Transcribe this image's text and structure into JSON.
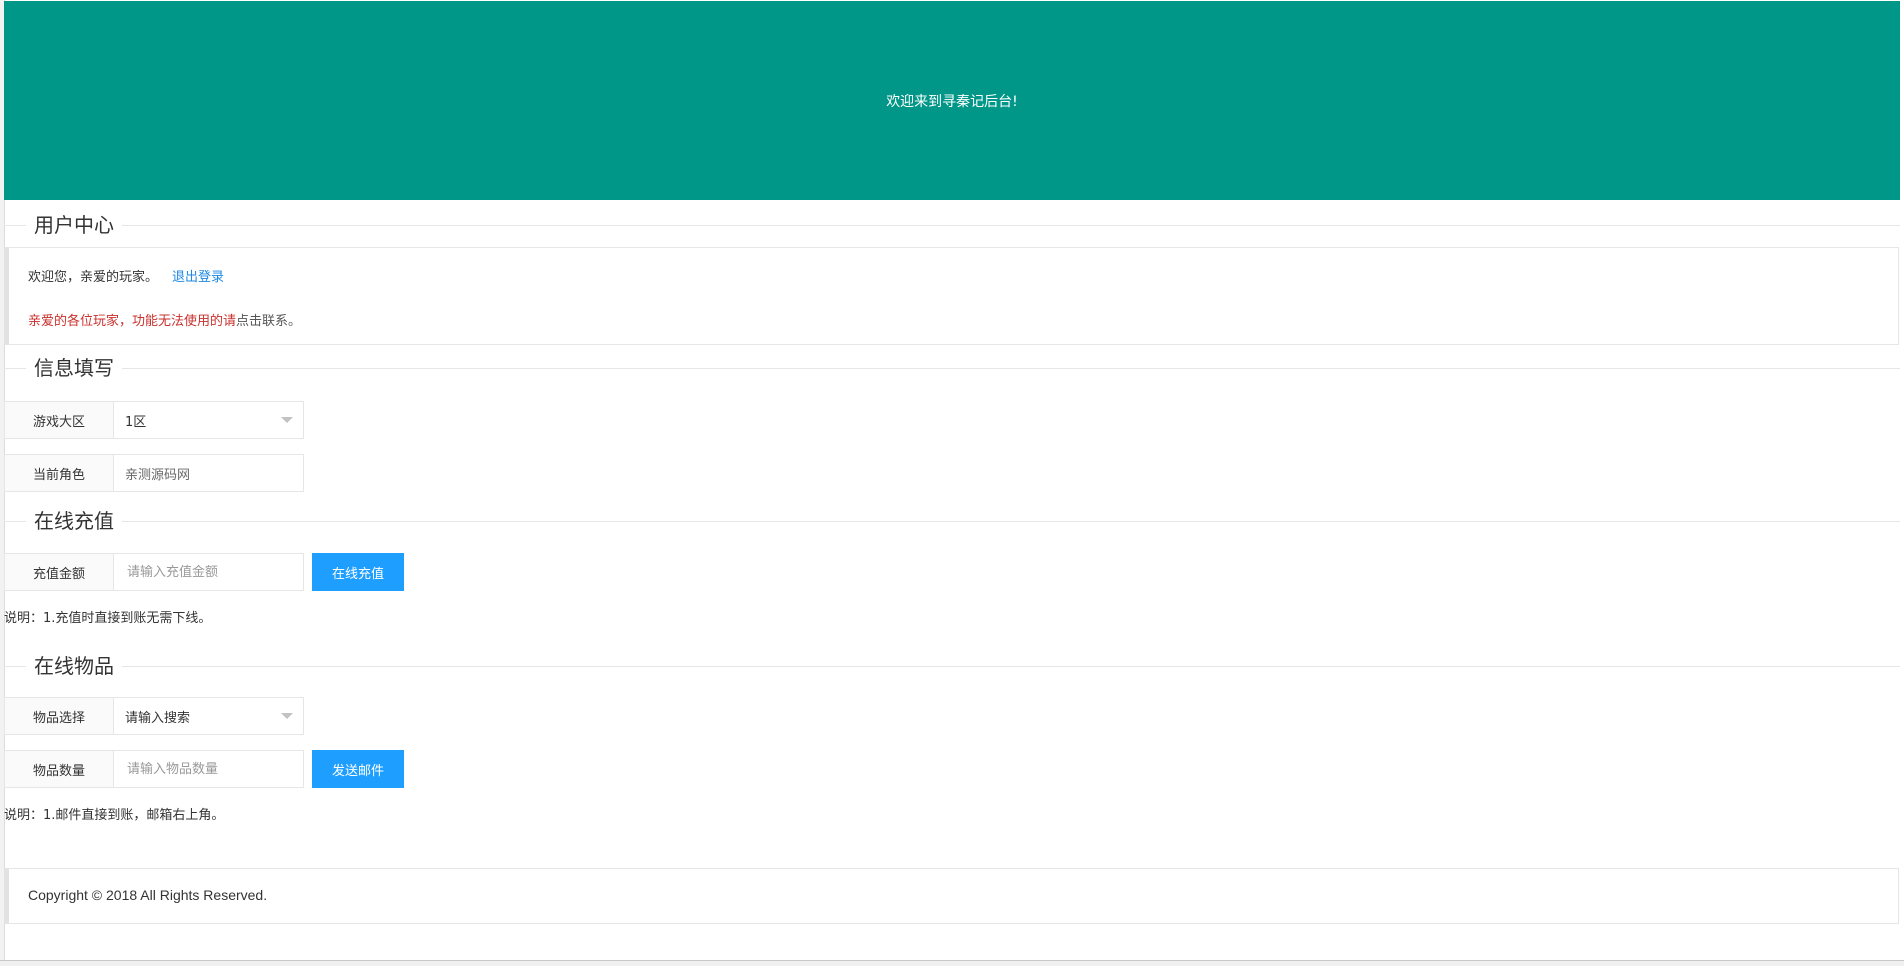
{
  "header": {
    "welcome_text": "欢迎来到寻秦记后台!"
  },
  "sections": {
    "user_center": {
      "title": "用户中心"
    },
    "info": {
      "title": "信息填写"
    },
    "recharge": {
      "title": "在线充值"
    },
    "items": {
      "title": "在线物品"
    }
  },
  "user_center": {
    "welcome": "欢迎您，亲爱的玩家。",
    "logout_label": "退出登录",
    "notice_red": "亲爱的各位玩家，功能无法使用的请",
    "notice_dark": "点击联系。"
  },
  "info_form": {
    "zone_label": "游戏大区",
    "zone_value": "1区",
    "role_label": "当前角色",
    "role_value": "亲测源码网"
  },
  "recharge_form": {
    "amount_label": "充值金额",
    "amount_placeholder": "请输入充值金额",
    "submit_label": "在线充值",
    "note": "说明：1.充值时直接到账无需下线。"
  },
  "items_form": {
    "item_label": "物品选择",
    "item_value": "请输入搜索",
    "quantity_label": "物品数量",
    "quantity_placeholder": "请输入物品数量",
    "submit_label": "发送邮件",
    "note": "说明：1.邮件直接到账，邮箱右上角。"
  },
  "footer": {
    "copyright": "Copyright © 2018 All Rights Reserved."
  },
  "colors": {
    "header_bg": "#009688",
    "button_bg": "#1e9fff",
    "link": "#1e88e5",
    "notice_red": "#c9302c"
  }
}
